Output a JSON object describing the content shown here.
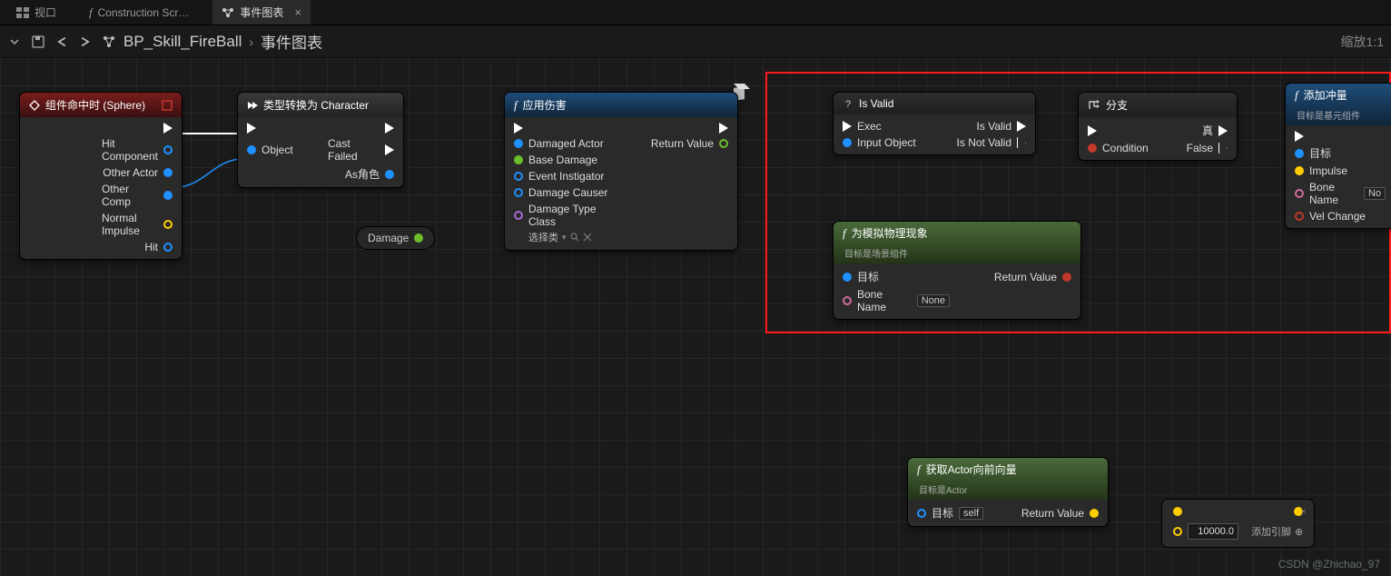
{
  "tabs": {
    "viewport": "视口",
    "construction": "Construction Scr…",
    "eventgraph": "事件图表"
  },
  "crumbs": {
    "bp": "BP_Skill_FireBall",
    "page": "事件图表"
  },
  "zoom": "缩放1:1",
  "nodes": {
    "hit": {
      "title": "组件命中时 (Sphere)",
      "pins": {
        "hitcomp": "Hit Component",
        "otheractor": "Other Actor",
        "othercomp": "Other Comp",
        "normalimpulse": "Normal Impulse",
        "hit": "Hit"
      }
    },
    "cast": {
      "title": "类型转换为 Character",
      "pins": {
        "object": "Object",
        "castfailed": "Cast Failed",
        "asrole": "As角色"
      }
    },
    "applydmg": {
      "title": "应用伤害",
      "pins": {
        "damagedactor": "Damaged Actor",
        "basedamage": "Base Damage",
        "eventinstigator": "Event Instigator",
        "damagecauser": "Damage Causer",
        "damagetype": "Damage Type Class",
        "select": "选择类",
        "returnvalue": "Return Value"
      }
    },
    "damagevar": "Damage",
    "isvalid": {
      "title": "Is Valid",
      "pins": {
        "exec": "Exec",
        "inputobj": "Input Object",
        "valid": "Is Valid",
        "notvalid": "Is Not Valid"
      }
    },
    "branch": {
      "title": "分支",
      "pins": {
        "condition": "Condition",
        "t": "真",
        "f": "False"
      }
    },
    "simphys": {
      "title": "为模拟物理现象",
      "sub": "目标是场景组件",
      "pins": {
        "target": "目标",
        "bonename": "Bone Name",
        "none": "None",
        "returnvalue": "Return Value"
      }
    },
    "addimpulse": {
      "title": "添加冲量",
      "sub": "目标是基元组件",
      "pins": {
        "target": "目标",
        "impulse": "Impulse",
        "bonename": "Bone Name",
        "none": "No",
        "velchange": "Vel Change"
      }
    },
    "getforward": {
      "title": "获取Actor向前向量",
      "sub": "目标是Actor",
      "pins": {
        "target": "目标",
        "self": "self",
        "returnvalue": "Return Value"
      }
    },
    "multiply": {
      "value": "10000.0",
      "addpin": "添加引脚"
    }
  },
  "watermark": "CSDN @Zhichao_97"
}
